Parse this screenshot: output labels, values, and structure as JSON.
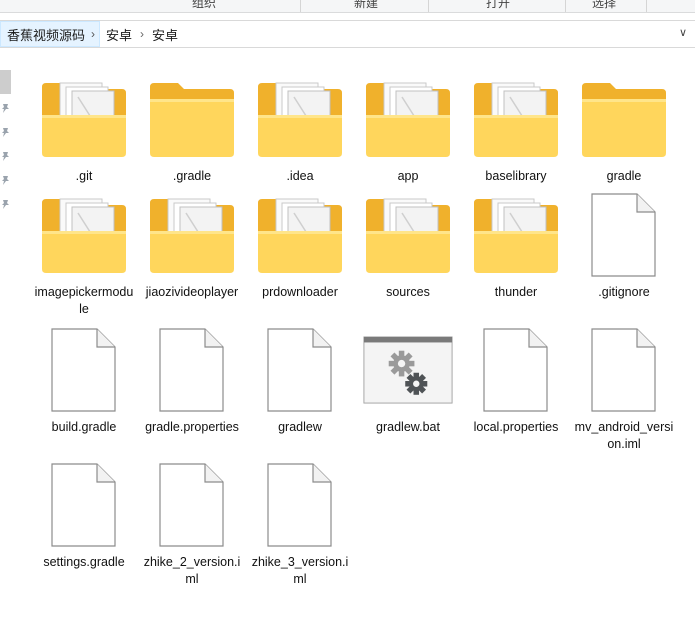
{
  "ribbon": {
    "groups": [
      "组织",
      "新建",
      "打开",
      "选择"
    ]
  },
  "address_bar": {
    "root": "香蕉视频源码",
    "crumbs": [
      "安卓",
      "安卓"
    ]
  },
  "icons": {
    "folder_with_files": "folder-with-documents-icon",
    "folder_empty": "folder-icon",
    "file_generic": "file-icon",
    "batch_file": "batch-file-gears-icon"
  },
  "colors": {
    "folder_back": "#f0b12c",
    "folder_front": "#ffd65c",
    "selection_crumb": "#e5f3ff"
  },
  "items": [
    {
      "name": ".git",
      "type": "folder_with_files"
    },
    {
      "name": ".gradle",
      "type": "folder_empty"
    },
    {
      "name": ".idea",
      "type": "folder_with_files"
    },
    {
      "name": "app",
      "type": "folder_with_files"
    },
    {
      "name": "baselibrary",
      "type": "folder_with_files"
    },
    {
      "name": "gradle",
      "type": "folder_empty"
    },
    {
      "name": "imagepickermodule",
      "type": "folder_with_files"
    },
    {
      "name": "jiaozivideoplayer",
      "type": "folder_with_files"
    },
    {
      "name": "prdownloader",
      "type": "folder_with_files"
    },
    {
      "name": "sources",
      "type": "folder_with_files"
    },
    {
      "name": "thunder",
      "type": "folder_with_files"
    },
    {
      "name": ".gitignore",
      "type": "file_generic"
    },
    {
      "name": "build.gradle",
      "type": "file_generic"
    },
    {
      "name": "gradle.properties",
      "type": "file_generic"
    },
    {
      "name": "gradlew",
      "type": "file_generic"
    },
    {
      "name": "gradlew.bat",
      "type": "batch_file"
    },
    {
      "name": "local.properties",
      "type": "file_generic"
    },
    {
      "name": "mv_android_version.iml",
      "type": "file_generic"
    },
    {
      "name": "settings.gradle",
      "type": "file_generic"
    },
    {
      "name": "zhike_2_version.iml",
      "type": "file_generic"
    },
    {
      "name": "zhike_3_version.iml",
      "type": "file_generic"
    }
  ]
}
